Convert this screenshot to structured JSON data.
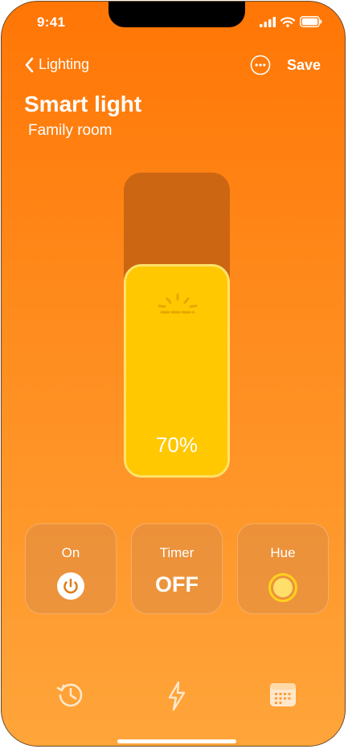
{
  "status_bar": {
    "time": "9:41"
  },
  "nav": {
    "back_label": "Lighting",
    "save_label": "Save"
  },
  "header": {
    "title": "Smart light",
    "subtitle": "Family room"
  },
  "brightness": {
    "value": 0.7,
    "label": "70%"
  },
  "controls": [
    {
      "label": "On",
      "icon": "power-icon"
    },
    {
      "label": "Timer",
      "value": "OFF"
    },
    {
      "label": "Hue",
      "icon": "color-dot-icon"
    }
  ],
  "bottom_bar": {
    "icons": [
      "history-icon",
      "lightning-icon",
      "calendar-icon"
    ]
  },
  "colors": {
    "accent_yellow": "#ffc800",
    "track": "#cc6612",
    "background_top": "#ff7605",
    "background_bottom": "#ffa53a"
  }
}
